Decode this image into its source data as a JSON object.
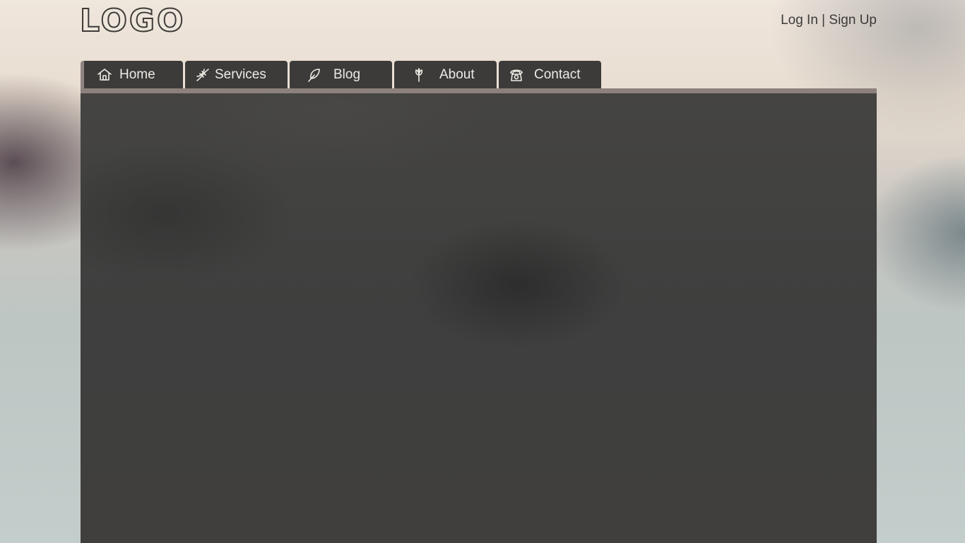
{
  "header": {
    "logo_text": "LOGO",
    "auth": {
      "login": "Log In",
      "separator": "|",
      "signup": "Sign Up"
    }
  },
  "nav": {
    "items": [
      {
        "label": "Home",
        "icon": "house-icon"
      },
      {
        "label": "Services",
        "icon": "dna-icon"
      },
      {
        "label": "Blog",
        "icon": "feather-icon"
      },
      {
        "label": "About",
        "icon": "flower-icon"
      },
      {
        "label": "Contact",
        "icon": "phone-icon"
      }
    ]
  },
  "colors": {
    "tab_bg": "#3c3b3a",
    "accent_stripe": "#8c817c",
    "content_bg": "#434241",
    "text_light": "#eeeae5",
    "text_dark": "#3d3a39"
  }
}
